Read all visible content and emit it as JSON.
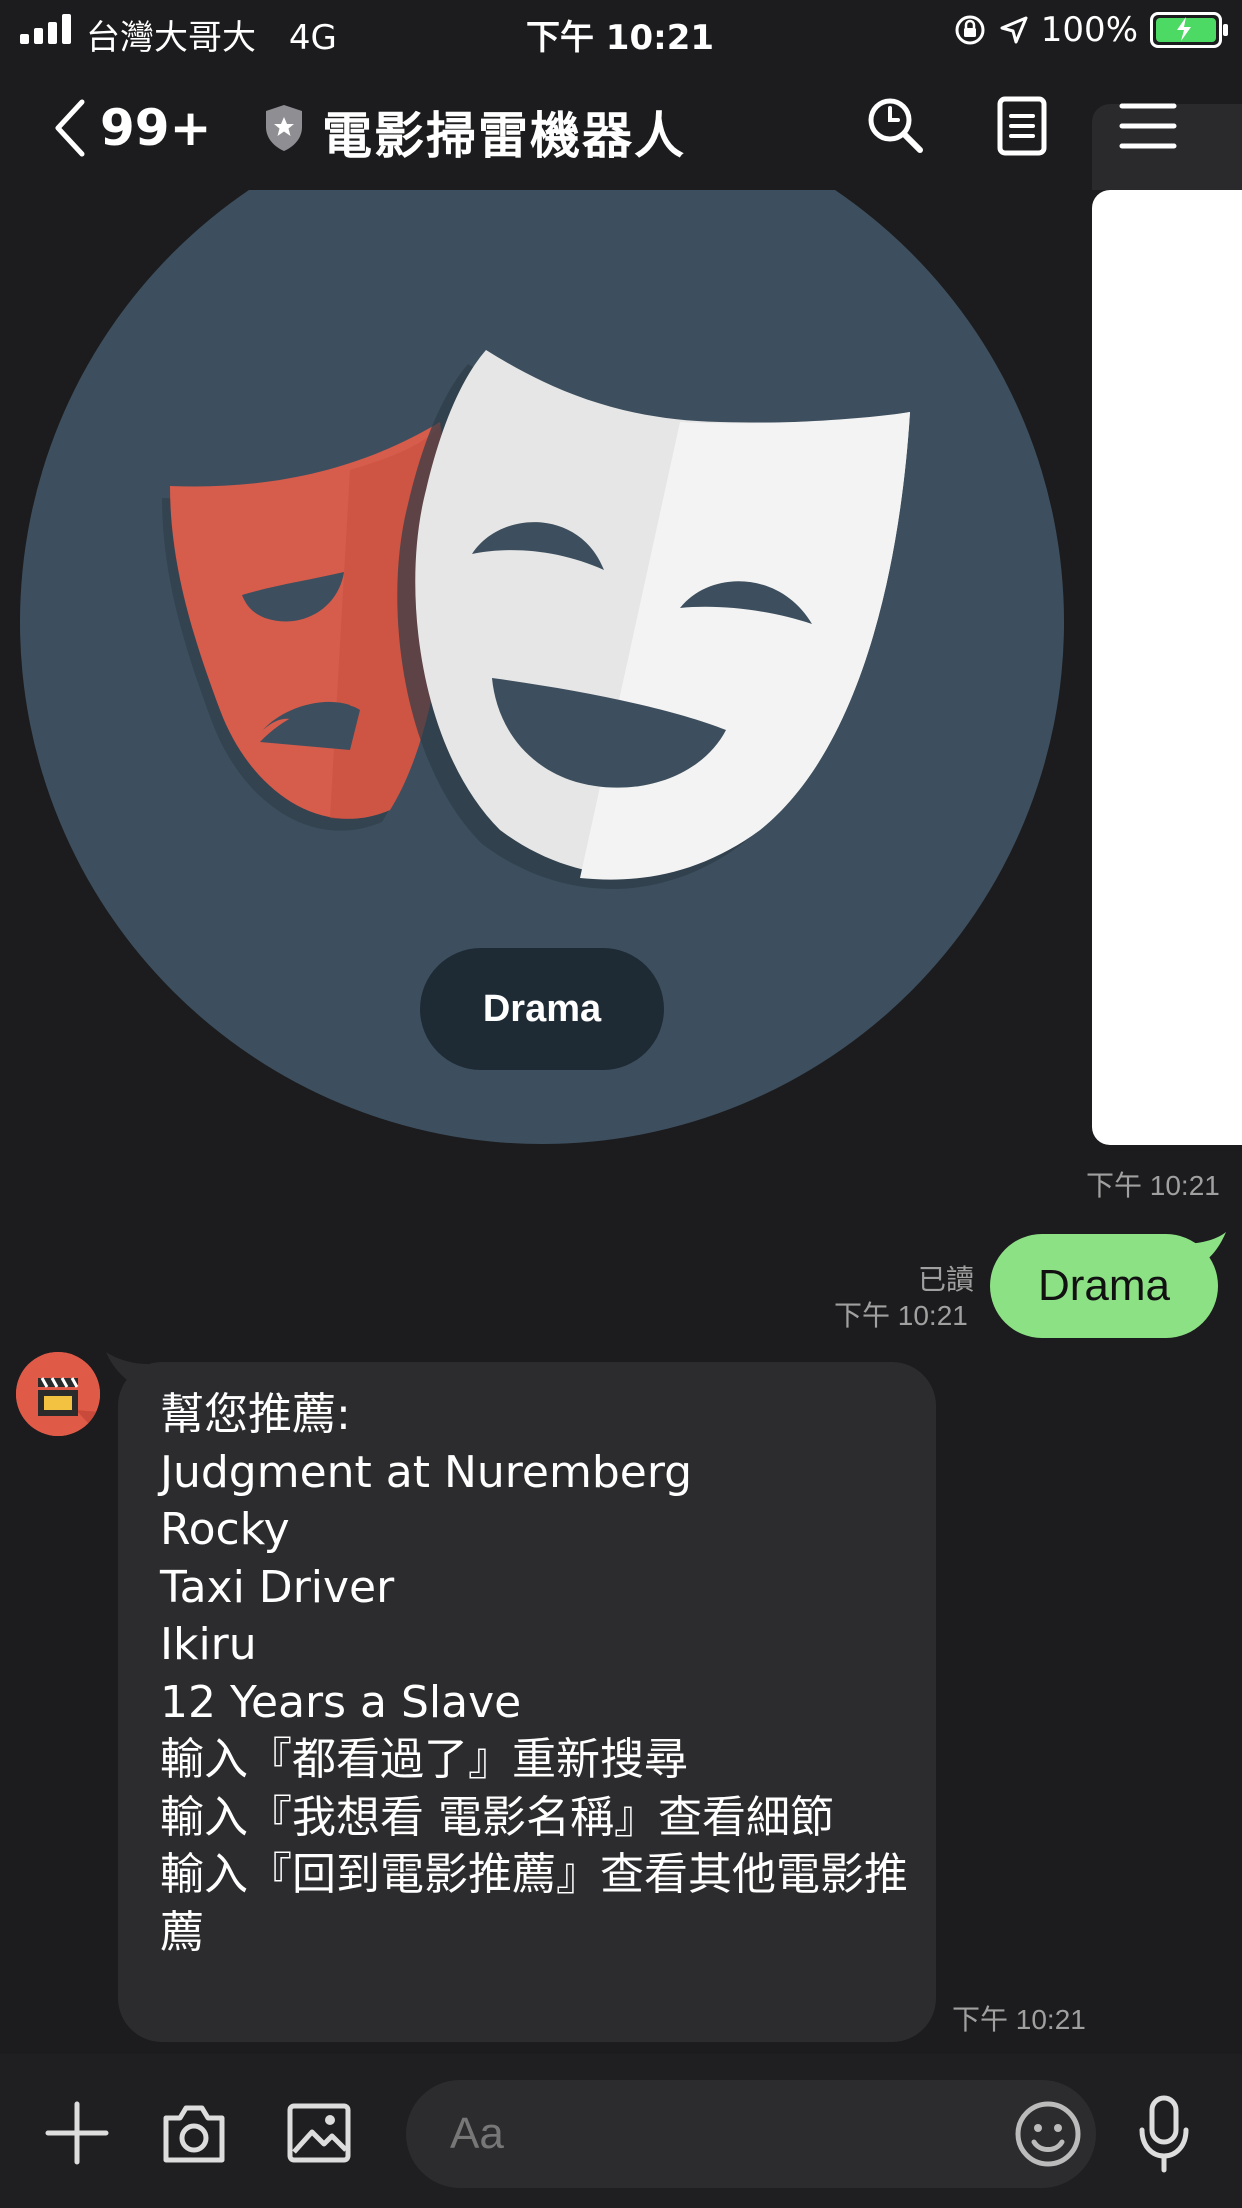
{
  "status_bar": {
    "carrier": "台灣大哥大",
    "network": "4G",
    "time": "下午 10:21",
    "battery": "100%"
  },
  "header": {
    "back_count": "99+",
    "title": "電影掃雷機器人"
  },
  "card": {
    "button_label": "Drama",
    "time": "下午 10:21"
  },
  "sent": {
    "text": "Drama",
    "read_label": "已讀",
    "time": "下午 10:21"
  },
  "received": {
    "text": "幫您推薦:\nJudgment at Nuremberg\nRocky\nTaxi Driver\nIkiru\n12 Years a Slave\n輸入『都看過了』重新搜尋\n輸入『我想看 電影名稱』查看細節\n輸入『回到電影推薦』查看其他電影推薦",
    "time": "下午 10:21"
  },
  "input": {
    "placeholder": "Aa"
  },
  "colors": {
    "background": "#1c1c1e",
    "sent_bubble": "#8de185",
    "received_bubble": "#2c2c2e",
    "card_circle": "#3d4f5e",
    "sad_mask": "#d65c4c",
    "happy_mask": "#eeeeee"
  }
}
